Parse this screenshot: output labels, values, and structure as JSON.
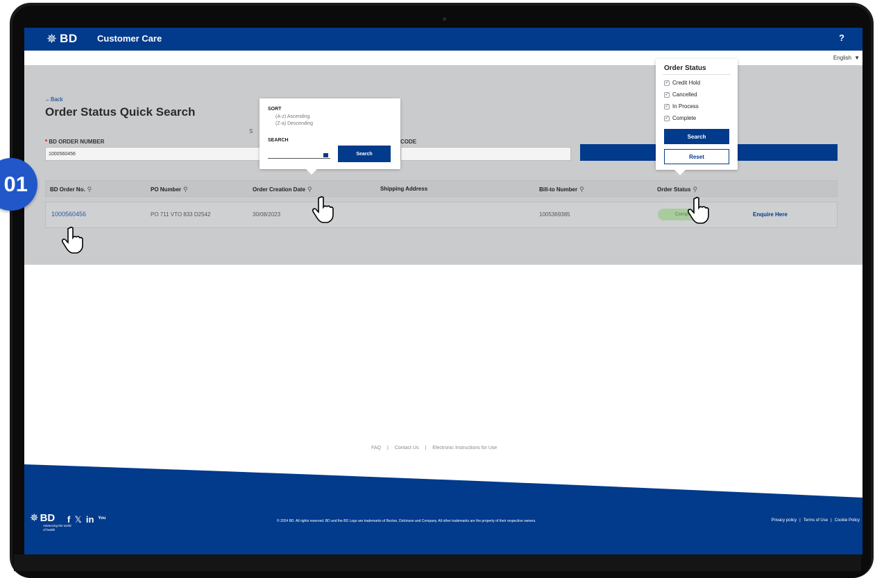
{
  "header": {
    "brand": "BD",
    "title": "Customer Care",
    "help": "?"
  },
  "language": {
    "selected": "English"
  },
  "page": {
    "back": "←Back",
    "title": "Order Status Quick Search",
    "order_number_label": "BD ORDER NUMBER",
    "order_number_value": "1000560456",
    "stray_label": "S",
    "code_label": "CODE"
  },
  "table": {
    "columns": {
      "bd_order_no": "BD Order No.",
      "po_number": "PO Number",
      "order_creation_date": "Order Creation Date",
      "shipping_address": "Shipping Address",
      "bill_to_number": "Bill-to Number",
      "order_status": "Order Status"
    },
    "rows": [
      {
        "bd_order_no": "1000560456",
        "po_number": "PO 711 VTO 833 D2542",
        "order_creation_date": "30/08/2023",
        "shipping_address": "",
        "bill_to_number": "1005369385",
        "order_status": "Compl",
        "action": "Enquire Here"
      }
    ]
  },
  "sort_popover": {
    "sort_title": "SORT",
    "asc": "(A-z) Ascending",
    "desc": "(Z-a) Descending",
    "search_title": "SEARCH",
    "search_button": "Search"
  },
  "status_popover": {
    "title": "Order Status",
    "options": [
      "Credit Hold",
      "Cancelled",
      "In Process",
      "Complete"
    ],
    "search_button": "Search",
    "reset_button": "Reset"
  },
  "footer": {
    "links": [
      "FAQ",
      "Contact Us",
      "Electronic Instructions for Use"
    ],
    "separator": "|",
    "brand": "BD",
    "tagline": "Advancing the world of health",
    "social": {
      "facebook": "f",
      "x": "𝕏",
      "linkedin": "in",
      "youtube": "You"
    },
    "copyright": "© 2024 BD. All rights reserved. BD and the BD Logo are trademarks of Becton, Dickinson and Company. All other trademarks are the property of their respective owners.",
    "policies": [
      "Privacy policy",
      "Terms of Use",
      "Cookie Policy"
    ]
  },
  "step_badge": "01",
  "colors": {
    "brand_blue": "#023a8c",
    "overlay_grey": "#cacbcd",
    "step_blue": "#2157c9"
  }
}
